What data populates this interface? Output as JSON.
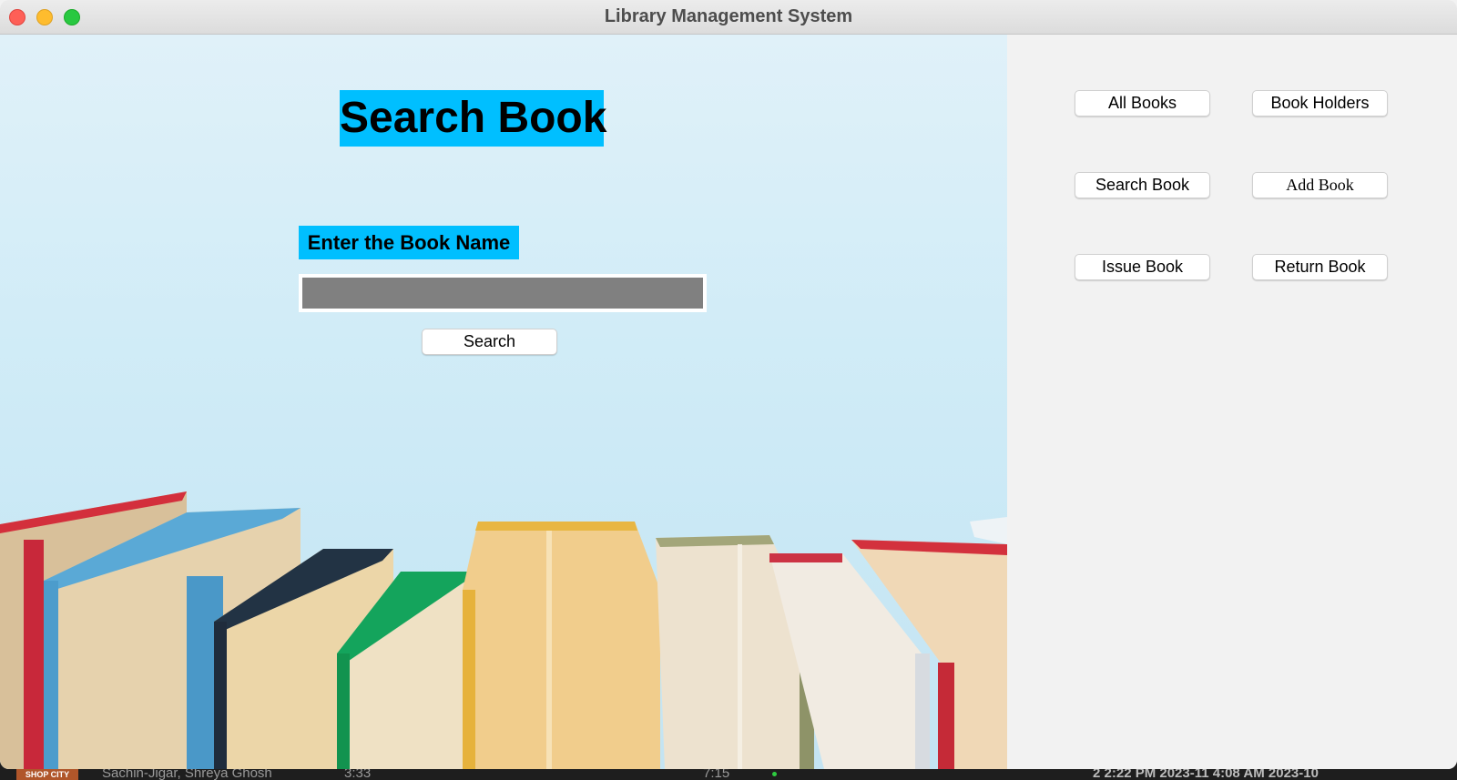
{
  "window": {
    "title": "Library Management System"
  },
  "search_form": {
    "heading": "Search Book",
    "field_label": "Enter the Book Name",
    "input_value": "",
    "search_button": "Search"
  },
  "menu": {
    "all_books": "All Books",
    "book_holders": "Book Holders",
    "search_book": "Search Book",
    "add_book": "Add Book",
    "issue_book": "Issue Book",
    "return_book": "Return Book"
  },
  "colors": {
    "label_background": "#00bfff",
    "input_background": "#808080",
    "panel_background": "#f2f2f2"
  },
  "background_taskbar": {
    "thumbnail_text": "SHOP CITY",
    "artist_text": "Sachin-Jigar, Shreya Ghosh",
    "time_1": "3:33",
    "time_2": "7:15",
    "dates_text": "2   2:22 PM   2023-11   4:08 AM   2023-10"
  }
}
